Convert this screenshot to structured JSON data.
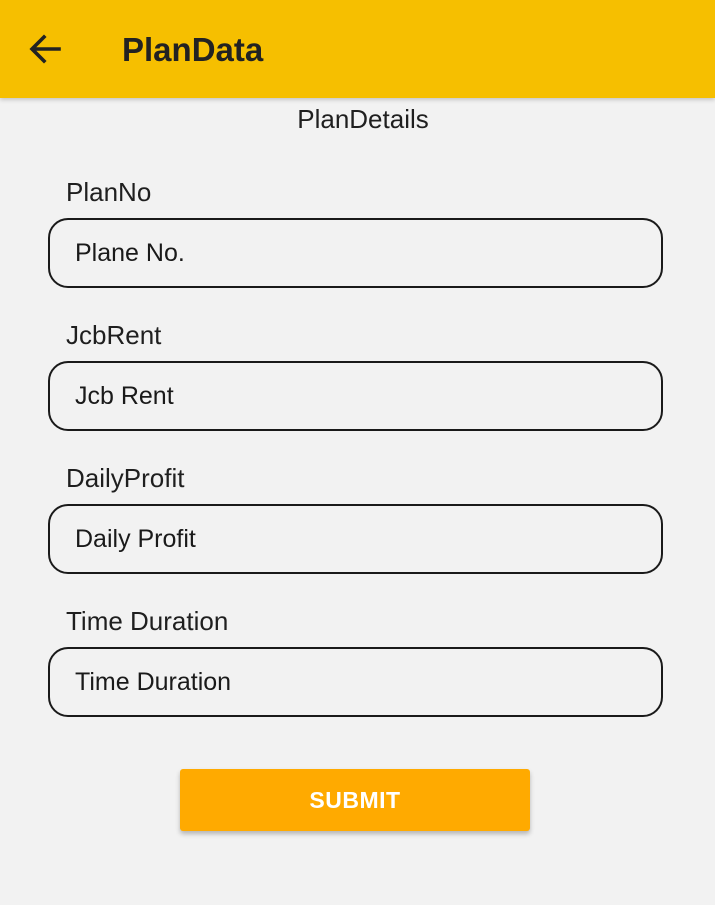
{
  "app_bar": {
    "title": "PlanData",
    "back_icon": "arrow-left-icon",
    "background_color": "#f6bf00"
  },
  "form": {
    "section_title": "PlanDetails",
    "fields": [
      {
        "label": "PlanNo",
        "placeholder": "Plane No.",
        "value": ""
      },
      {
        "label": "JcbRent",
        "placeholder": "Jcb Rent",
        "value": ""
      },
      {
        "label": "DailyProfit",
        "placeholder": "Daily Profit",
        "value": ""
      },
      {
        "label": "Time Duration",
        "placeholder": "Time Duration",
        "value": ""
      }
    ],
    "submit_label": "SUBMIT",
    "submit_color": "#ffaa00"
  }
}
